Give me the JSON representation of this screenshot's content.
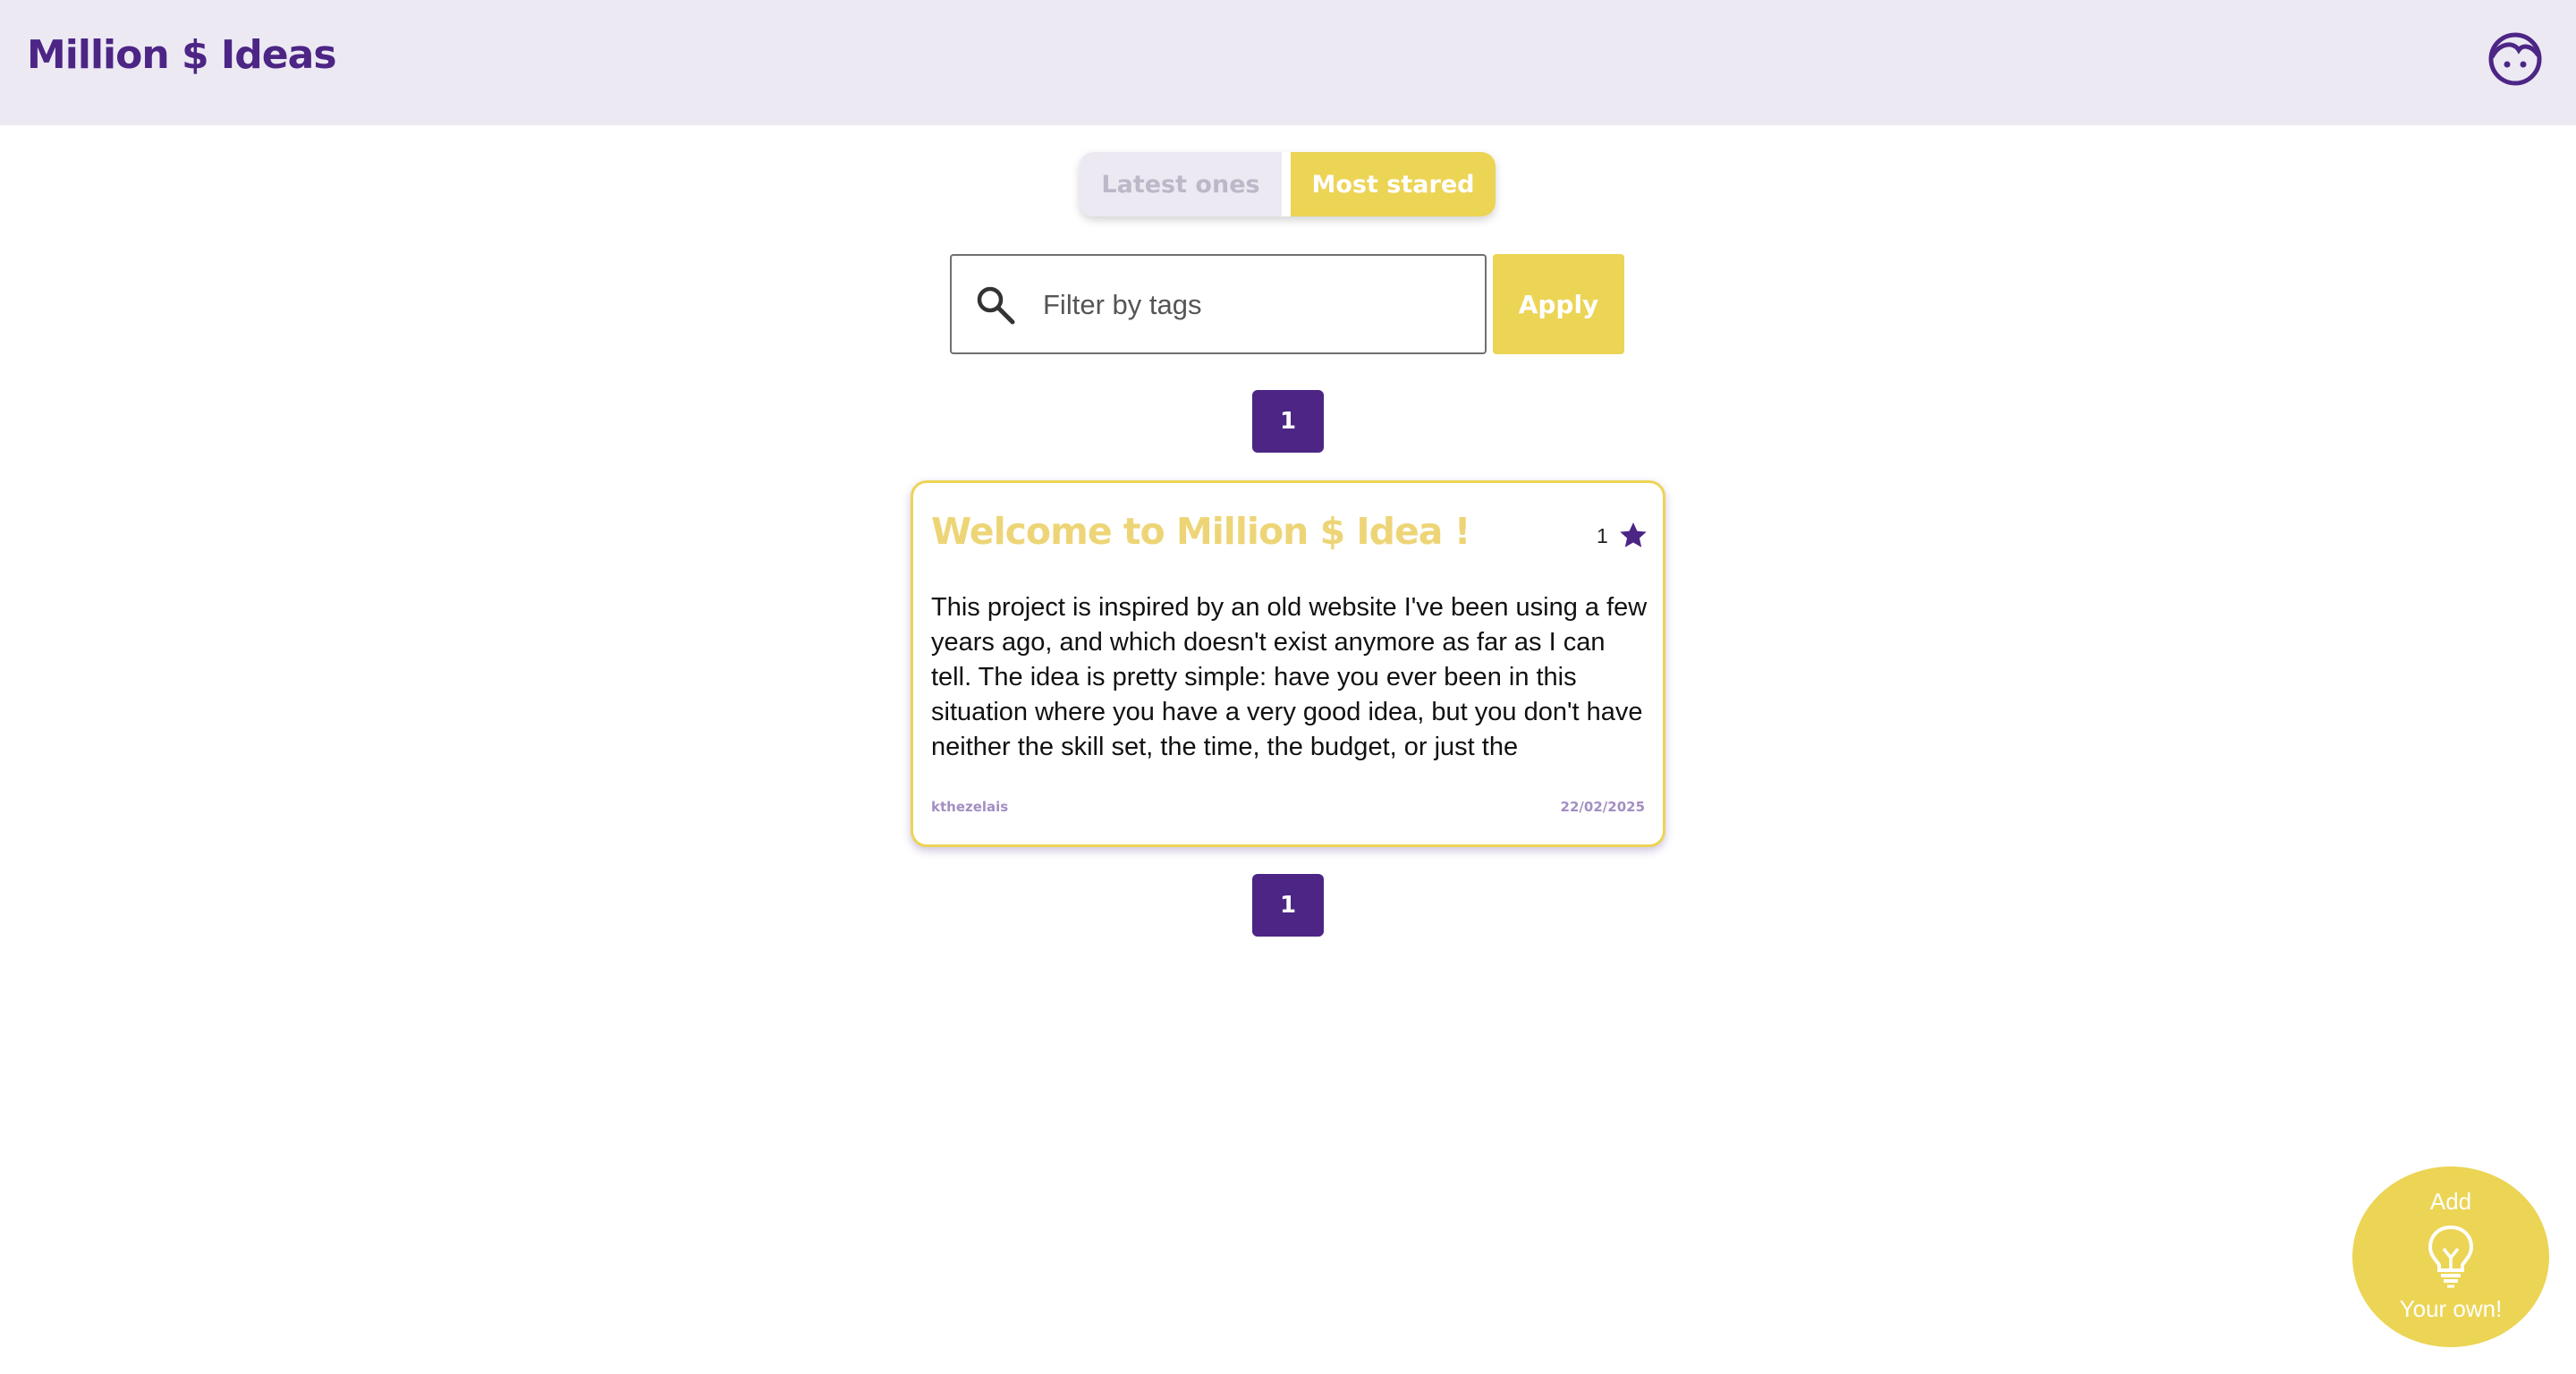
{
  "header": {
    "title": "Million $ Ideas",
    "profile_icon": "user-face-icon"
  },
  "sort_toggle": {
    "latest_label": "Latest ones",
    "most_stared_label": "Most stared",
    "active": "Most stared"
  },
  "search": {
    "placeholder": "Filter by tags",
    "value": "",
    "icon": "search-icon",
    "apply_label": "Apply"
  },
  "pagination": {
    "current_page": "1"
  },
  "ideas": [
    {
      "title": "Welcome to Million $ Idea !",
      "stars": "1",
      "star_icon": "star-icon",
      "body": "This project is inspired by an old website I've been using a few years ago, and which doesn't exist anymore as far as I can tell. The idea is pretty simple: have you ever been in this situation where you have a very good idea, but you don't have neither the skill set, the time, the budget, or just the",
      "author": "kthezelais",
      "date": "22/02/2025"
    }
  ],
  "fab": {
    "top_label": "Add",
    "bottom_label": "Your own!",
    "icon": "lightbulb-icon"
  },
  "colors": {
    "primary": "#4C2585",
    "accent": "#ECD455",
    "header_bg": "#ECE9F3"
  }
}
